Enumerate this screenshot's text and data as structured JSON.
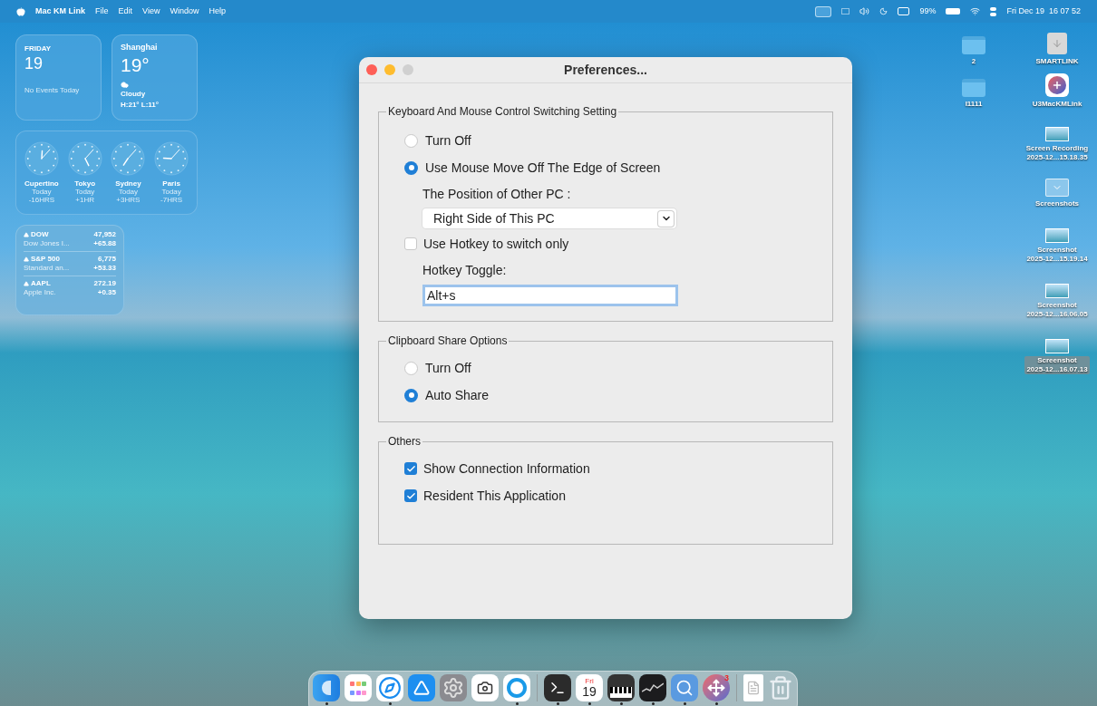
{
  "menu_bar": {
    "app_name": "Mac KM Link",
    "menus": [
      "File",
      "Edit",
      "View",
      "Window",
      "Help"
    ],
    "battery": "99%",
    "datetime": "Fri Dec 19  16 07 52"
  },
  "widgets": {
    "calendar": {
      "day_name": "FRIDAY",
      "date": "19",
      "events": "No Events Today"
    },
    "weather": {
      "city": "Shanghai",
      "temperature": "19°",
      "condition": "Cloudy",
      "range": "H:21° L:11°"
    },
    "world_clock": [
      {
        "city": "Cupertino",
        "day": "Today",
        "offset": "-16HRS"
      },
      {
        "city": "Tokyo",
        "day": "Today",
        "offset": "+1HR"
      },
      {
        "city": "Sydney",
        "day": "Today",
        "offset": "+3HRS"
      },
      {
        "city": "Paris",
        "day": "Today",
        "offset": "-7HRS"
      }
    ],
    "stocks": [
      {
        "symbol": "DOW",
        "name": "Dow Jones I...",
        "price": "47,952",
        "change": "+65.88"
      },
      {
        "symbol": "S&P 500",
        "name": "Standard an...",
        "price": "6,775",
        "change": "+53.33"
      },
      {
        "symbol": "AAPL",
        "name": "Apple Inc.",
        "price": "272.19",
        "change": "+0.35"
      }
    ]
  },
  "desktop_icons": [
    {
      "kind": "folder",
      "label": "2",
      "selected": false
    },
    {
      "kind": "drive",
      "label": "SMARTLINK",
      "selected": false
    },
    {
      "kind": "folder",
      "label": "I1111",
      "selected": false
    },
    {
      "kind": "app",
      "label": "U3MacKMLink",
      "selected": false
    },
    {
      "kind": "image",
      "label": "Screen Recording",
      "sublabel": "2025-12...15.18.35",
      "selected": false
    },
    {
      "kind": "stack",
      "label": "Screenshots",
      "selected": false
    },
    {
      "kind": "image",
      "label": "Screenshot",
      "sublabel": "2025-12...15.19.14",
      "selected": false
    },
    {
      "kind": "image",
      "label": "Screenshot",
      "sublabel": "2025-12...16.06.05",
      "selected": false
    },
    {
      "kind": "image",
      "label": "Screenshot",
      "sublabel": "2025-12...16.07.13",
      "selected": true
    }
  ],
  "dialog": {
    "title": "Preferences...",
    "sections": [
      {
        "title": "Keyboard And Mouse Control Switching Setting",
        "items": [
          {
            "kind": "radio",
            "label": "Turn Off",
            "selected": false
          },
          {
            "kind": "radio",
            "label": "Use Mouse Move Off The Edge of Screen",
            "selected": true
          },
          {
            "kind": "label",
            "label": "The Position of Other PC :"
          },
          {
            "kind": "select",
            "value": "Right Side of This PC"
          },
          {
            "kind": "checkbox",
            "label": "Use Hotkey to switch only",
            "checked": false
          },
          {
            "kind": "label",
            "label": "Hotkey Toggle:"
          },
          {
            "kind": "input",
            "value": "Alt+s"
          }
        ]
      },
      {
        "title": "Clipboard Share Options",
        "items": [
          {
            "kind": "radio",
            "label": "Turn Off",
            "selected": false
          },
          {
            "kind": "radio",
            "label": "Auto Share",
            "selected": true
          }
        ]
      },
      {
        "title": "Others",
        "items": [
          {
            "kind": "checkbox",
            "label": "Show Connection Information",
            "checked": true
          },
          {
            "kind": "checkbox",
            "label": "Resident This Application",
            "checked": true
          }
        ]
      }
    ]
  },
  "dock": [
    {
      "kind": "finder",
      "running": true
    },
    {
      "kind": "launchpad",
      "running": false
    },
    {
      "kind": "safari",
      "running": true
    },
    {
      "kind": "appstore",
      "running": false
    },
    {
      "kind": "settings",
      "running": false
    },
    {
      "kind": "screenshot",
      "running": false
    },
    {
      "kind": "quicktime",
      "running": true
    },
    {
      "kind": "divider"
    },
    {
      "kind": "terminal",
      "running": true
    },
    {
      "kind": "calendar",
      "running": true,
      "weekday": "Fri",
      "date": "19"
    },
    {
      "kind": "piano",
      "running": true
    },
    {
      "kind": "stocks",
      "running": true
    },
    {
      "kind": "preview",
      "running": true
    },
    {
      "kind": "kmlink",
      "running": true,
      "badge": "3"
    },
    {
      "kind": "divider"
    },
    {
      "kind": "document",
      "running": false
    },
    {
      "kind": "trash",
      "running": false
    }
  ]
}
